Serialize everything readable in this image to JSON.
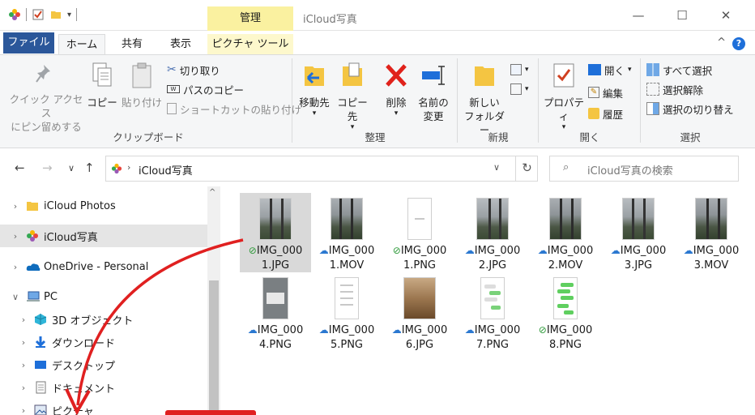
{
  "window": {
    "title": "iCloud写真",
    "context_tab_group": "管理"
  },
  "tabs": {
    "file": "ファイル",
    "home": "ホーム",
    "share": "共有",
    "view": "表示",
    "picture_tools": "ピクチャ ツール"
  },
  "ribbon": {
    "clipboard": {
      "label": "クリップボード",
      "pin_line1": "クイック アクセス",
      "pin_line2": "にピン留めする",
      "copy": "コピー",
      "paste": "貼り付け",
      "cut": "切り取り",
      "copy_path": "パスのコピー",
      "paste_shortcut": "ショートカットの貼り付け"
    },
    "organize": {
      "label": "整理",
      "move_to": "移動先",
      "copy_to": "コピー先",
      "delete": "削除",
      "rename_line1": "名前の",
      "rename_line2": "変更"
    },
    "new": {
      "label": "新規",
      "new_folder_line1": "新しい",
      "new_folder_line2": "フォルダー"
    },
    "open": {
      "label": "開く",
      "properties": "プロパティ",
      "open": "開く",
      "edit": "編集",
      "history": "履歴"
    },
    "select": {
      "label": "選択",
      "select_all": "すべて選択",
      "select_none": "選択解除",
      "invert": "選択の切り替え"
    }
  },
  "address": {
    "path": "iCloud写真",
    "search_placeholder": "iCloud写真の検索"
  },
  "nav": {
    "items": [
      {
        "label": "iCloud Photos",
        "icon": "folder-icon"
      },
      {
        "label": "iCloud写真",
        "icon": "icloud-photos-icon"
      },
      {
        "label": "OneDrive - Personal",
        "icon": "onedrive-icon"
      },
      {
        "label": "PC",
        "icon": "pc-icon"
      },
      {
        "label": "3D オブジェクト",
        "icon": "3d-objects-icon"
      },
      {
        "label": "ダウンロード",
        "icon": "download-icon"
      },
      {
        "label": "デスクトップ",
        "icon": "desktop-icon"
      },
      {
        "label": "ドキュメント",
        "icon": "documents-icon"
      },
      {
        "label": "ピクチャ",
        "icon": "pictures-icon"
      }
    ]
  },
  "files": [
    {
      "line1": "IMG_000",
      "line2": "1.JPG",
      "status": "check",
      "kind": "photo"
    },
    {
      "line1": "IMG_000",
      "line2": "1.MOV",
      "status": "cloud",
      "kind": "video"
    },
    {
      "line1": "IMG_000",
      "line2": "1.PNG",
      "status": "check",
      "kind": "doc"
    },
    {
      "line1": "IMG_000",
      "line2": "2.JPG",
      "status": "cloud",
      "kind": "photo"
    },
    {
      "line1": "IMG_000",
      "line2": "2.MOV",
      "status": "cloud",
      "kind": "video"
    },
    {
      "line1": "IMG_000",
      "line2": "3.JPG",
      "status": "cloud",
      "kind": "photo"
    },
    {
      "line1": "IMG_000",
      "line2": "3.MOV",
      "status": "cloud",
      "kind": "video"
    },
    {
      "line1": "IMG_000",
      "line2": "4.PNG",
      "status": "cloud",
      "kind": "grey"
    },
    {
      "line1": "IMG_000",
      "line2": "5.PNG",
      "status": "cloud",
      "kind": "doc"
    },
    {
      "line1": "IMG_000",
      "line2": "6.JPG",
      "status": "cloud",
      "kind": "brown"
    },
    {
      "line1": "IMG_000",
      "line2": "7.PNG",
      "status": "cloud",
      "kind": "chat"
    },
    {
      "line1": "IMG_000",
      "line2": "8.PNG",
      "status": "check",
      "kind": "chat"
    }
  ],
  "colors": {
    "file_tab": "#2b579a",
    "context_tab": "#faf1a0",
    "annotation_arrow": "#e02020",
    "cloud_status": "#2b78d0",
    "synced_status": "#2e9a3a"
  }
}
